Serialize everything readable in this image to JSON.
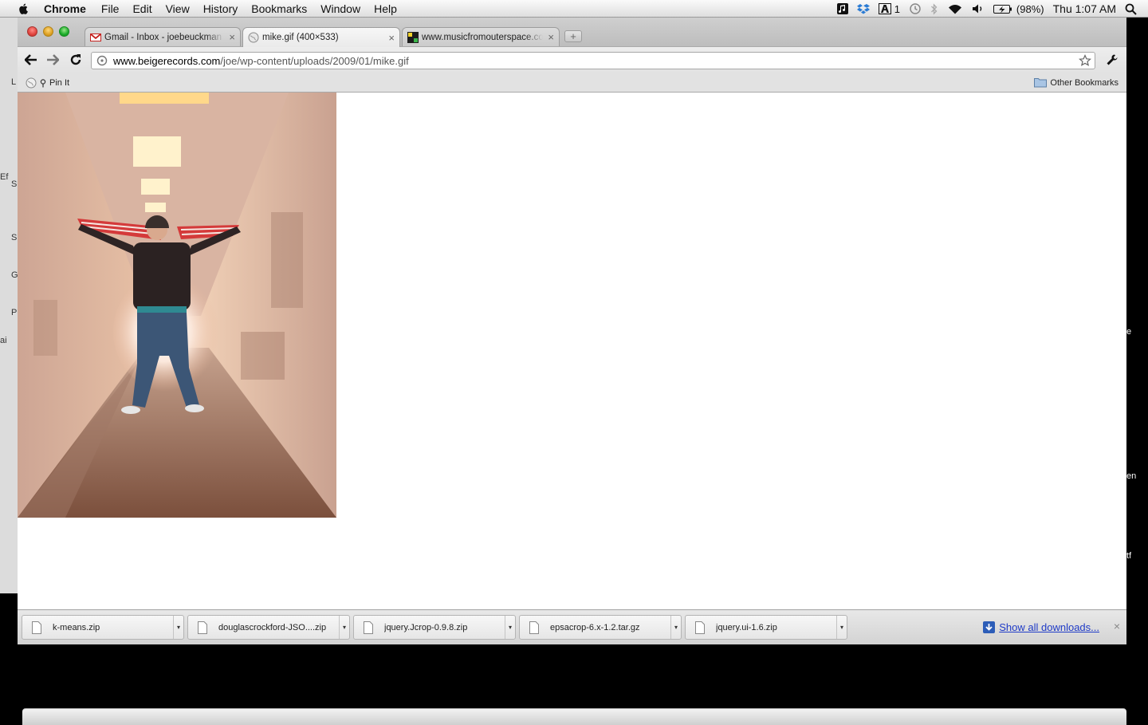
{
  "menubar": {
    "app_name": "Chrome",
    "items": [
      "File",
      "Edit",
      "View",
      "History",
      "Bookmarks",
      "Window",
      "Help"
    ],
    "status": {
      "adobe_count": "1",
      "battery": "(98%)",
      "clock": "Thu 1:07 AM"
    }
  },
  "tabs": [
    {
      "title": "Gmail - Inbox - joebeuckman",
      "favicon": "gmail-icon",
      "active": false
    },
    {
      "title": "mike.gif (400×533)",
      "favicon": "globe-icon",
      "active": true
    },
    {
      "title": "www.musicfromouterspace.com",
      "favicon": "mfos-icon",
      "active": false
    }
  ],
  "tab_close_glyph": "×",
  "new_tab_glyph": "+",
  "favicon_text": {
    "mfos": "MF OS"
  },
  "omnibox": {
    "host": "www.beigerecords.com",
    "path": "/joe/wp-content/uploads/2009/01/mike.gif"
  },
  "bookmarks": {
    "pin_it": "Pin It",
    "other": "Other Bookmarks"
  },
  "image_alt": "mike.gif",
  "downloads": [
    {
      "name": "k-means.zip"
    },
    {
      "name": "douglascrockford-JSO....zip"
    },
    {
      "name": "jquery.Jcrop-0.9.8.zip"
    },
    {
      "name": "epsacrop-6.x-1.2.tar.gz"
    },
    {
      "name": "jquery.ui-1.6.zip"
    }
  ],
  "dropdown_glyph": "▾",
  "shelf": {
    "show_all": "Show all downloads...",
    "close": "×"
  },
  "background_letters": [
    "L",
    "Ef",
    "S",
    "S",
    "G",
    "P",
    "ai",
    "e",
    "en",
    "tf"
  ],
  "colors": {
    "link": "#1f3bc7",
    "close_red": "#e0443e",
    "minimize_yellow": "#dea123",
    "zoom_green": "#1aab29"
  }
}
